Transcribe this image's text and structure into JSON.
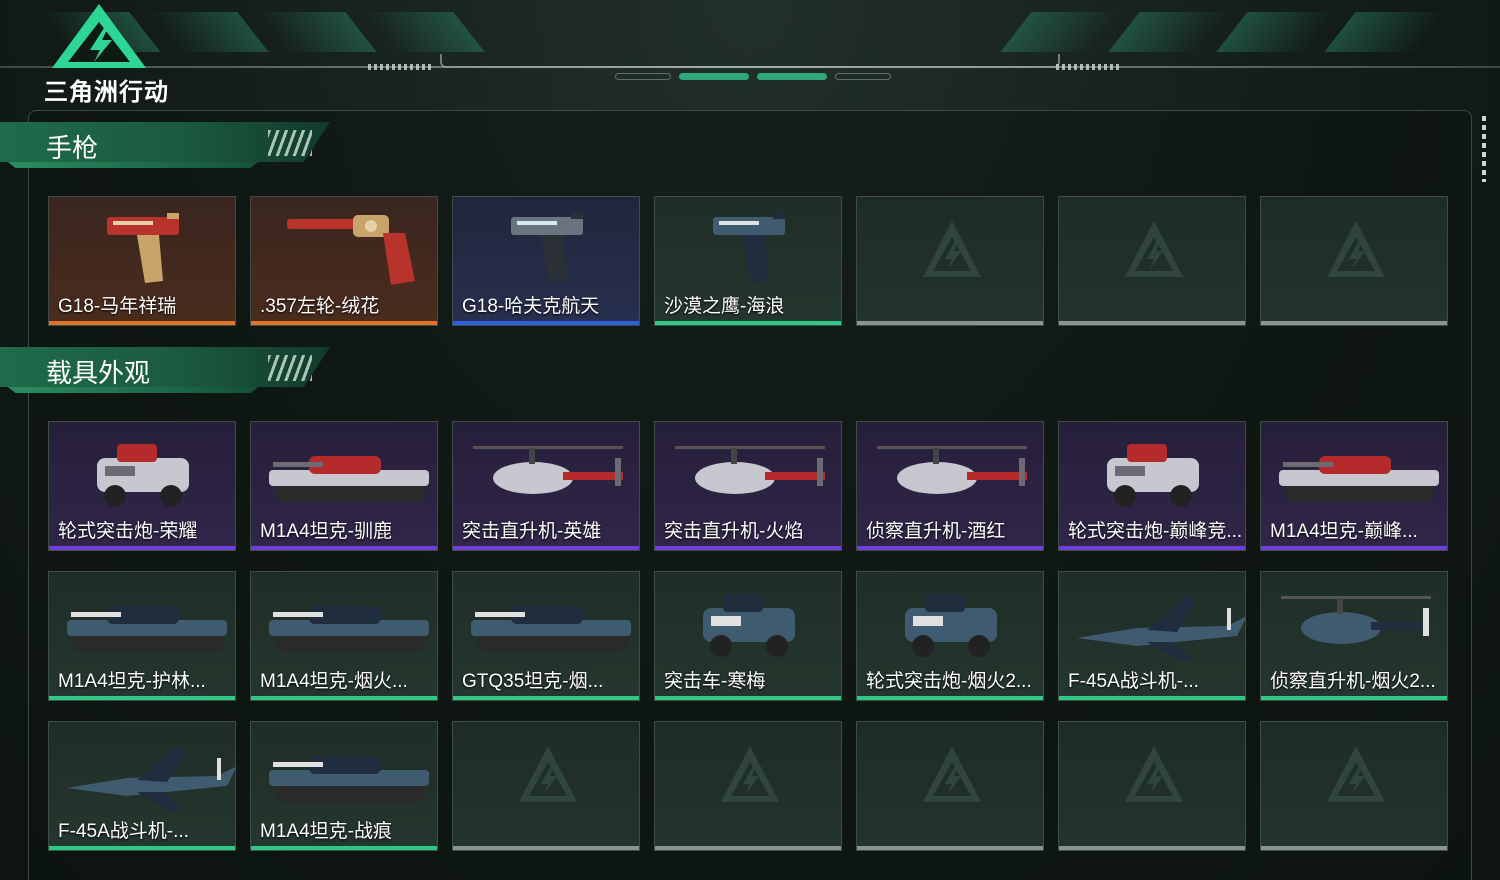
{
  "header": {
    "logo_text": "三角洲行动"
  },
  "colors": {
    "orange": "#e2732b",
    "blue": "#2f5fe0",
    "purple": "#6f3fd8",
    "green": "#2ec987",
    "gray": "#8c948f"
  },
  "sections": [
    {
      "title": "手枪"
    },
    {
      "title": "载具外观"
    }
  ],
  "pistols": [
    {
      "name": "G18-马年祥瑞",
      "quality": "orange",
      "icon": "pistol-icon"
    },
    {
      "name": ".357左轮-绒花",
      "quality": "orange",
      "icon": "revolver-icon"
    },
    {
      "name": "G18-哈夫克航天",
      "quality": "blue",
      "icon": "pistol-icon"
    },
    {
      "name": "沙漠之鹰-海浪",
      "quality": "green",
      "icon": "pistol-icon"
    }
  ],
  "vehicles": [
    {
      "name": "轮式突击炮-荣耀",
      "quality": "purple",
      "icon": "armored-car-icon"
    },
    {
      "name": "M1A4坦克-驯鹿",
      "quality": "purple",
      "icon": "tank-icon"
    },
    {
      "name": "突击直升机-英雄",
      "quality": "purple",
      "icon": "helicopter-icon"
    },
    {
      "name": "突击直升机-火焰",
      "quality": "purple",
      "icon": "helicopter-icon"
    },
    {
      "name": "侦察直升机-酒红",
      "quality": "purple",
      "icon": "helicopter-icon"
    },
    {
      "name": "轮式突击炮-巅峰竞...",
      "quality": "purple",
      "icon": "armored-car-icon"
    },
    {
      "name": "M1A4坦克-巅峰...",
      "quality": "purple",
      "icon": "tank-icon"
    },
    {
      "name": "M1A4坦克-护林...",
      "quality": "green",
      "icon": "tank-icon"
    },
    {
      "name": "M1A4坦克-烟火...",
      "quality": "green",
      "icon": "tank-icon"
    },
    {
      "name": "GTQ35坦克-烟...",
      "quality": "green",
      "icon": "tank-icon"
    },
    {
      "name": "突击车-寒梅",
      "quality": "green",
      "icon": "armored-car-icon"
    },
    {
      "name": "轮式突击炮-烟火2...",
      "quality": "green",
      "icon": "armored-car-icon"
    },
    {
      "name": "F-45A战斗机-...",
      "quality": "green",
      "icon": "jet-icon"
    },
    {
      "name": "侦察直升机-烟火2...",
      "quality": "green",
      "icon": "helicopter-icon"
    },
    {
      "name": "F-45A战斗机-...",
      "quality": "green",
      "icon": "jet-icon"
    },
    {
      "name": "M1A4坦克-战痕",
      "quality": "green",
      "icon": "tank-icon"
    }
  ]
}
